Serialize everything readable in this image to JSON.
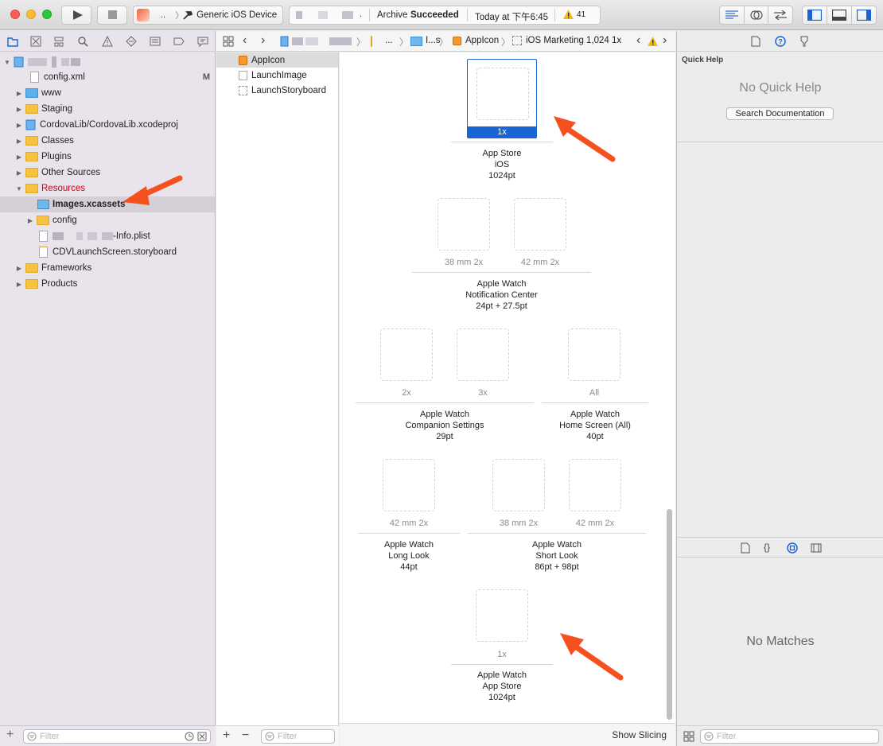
{
  "toolbar": {
    "scheme_name": "..",
    "destination": "Generic iOS Device",
    "activity_project": ".",
    "activity_status_prefix": "Archive",
    "activity_status": "Succeeded",
    "activity_time": "Today at 下午6:45",
    "warning_count": "41"
  },
  "navigator": {
    "project_name": "",
    "items": [
      {
        "label": "config.xml",
        "badge": "M"
      },
      {
        "label": "www"
      },
      {
        "label": "Staging"
      },
      {
        "label": "CordovaLib/CordovaLib.xcodeproj"
      },
      {
        "label": "Classes"
      },
      {
        "label": "Plugins"
      },
      {
        "label": "Other Sources"
      },
      {
        "label": "Resources"
      },
      {
        "label": "Images.xcassets"
      },
      {
        "label": "config"
      },
      {
        "label": "-Info.plist"
      },
      {
        "label": "CDVLaunchScreen.storyboard"
      },
      {
        "label": "Frameworks"
      },
      {
        "label": "Products"
      }
    ],
    "filter_placeholder": "Filter"
  },
  "jumpbar": {
    "crumb_folder": "...",
    "crumb_assets": "I...s",
    "crumb_set": "AppIcon",
    "crumb_slot": "iOS Marketing 1,024 1x"
  },
  "asset_list": {
    "items": [
      "AppIcon",
      "LaunchImage",
      "LaunchStoryboard"
    ],
    "filter_placeholder": "Filter"
  },
  "editor": {
    "groups": {
      "app_store": {
        "slot": "1x",
        "title1": "App Store",
        "title2": "iOS",
        "title3": "1024pt"
      },
      "notification": {
        "slot_a": "38 mm 2x",
        "slot_b": "42 mm 2x",
        "title1": "Apple Watch",
        "title2": "Notification Center",
        "title3": "24pt + 27.5pt"
      },
      "companion": {
        "slot_a": "2x",
        "slot_b": "3x",
        "title1": "Apple Watch",
        "title2": "Companion Settings",
        "title3": "29pt"
      },
      "home_screen": {
        "slot_a": "All",
        "title1": "Apple Watch",
        "title2": "Home Screen (All)",
        "title3": "40pt"
      },
      "long_look": {
        "slot_a": "42 mm 2x",
        "title1": "Apple Watch",
        "title2": "Long Look",
        "title3": "44pt"
      },
      "short_look": {
        "slot_a": "38 mm 2x",
        "slot_b": "42 mm 2x",
        "title1": "Apple Watch",
        "title2": "Short Look",
        "title3": "86pt + 98pt"
      },
      "watch_store": {
        "slot": "1x",
        "title1": "Apple Watch",
        "title2": "App Store",
        "title3": "1024pt"
      }
    },
    "show_slicing": "Show Slicing"
  },
  "inspector": {
    "quick_help_title": "Quick Help",
    "no_quick_help": "No Quick Help",
    "search_documentation": "Search Documentation",
    "no_matches": "No Matches",
    "filter_placeholder": "Filter"
  },
  "colors": {
    "accent": "#1a64d3",
    "arrow": "#f4511e",
    "folder": "#f5c242",
    "resources_text": "#d0021b"
  }
}
